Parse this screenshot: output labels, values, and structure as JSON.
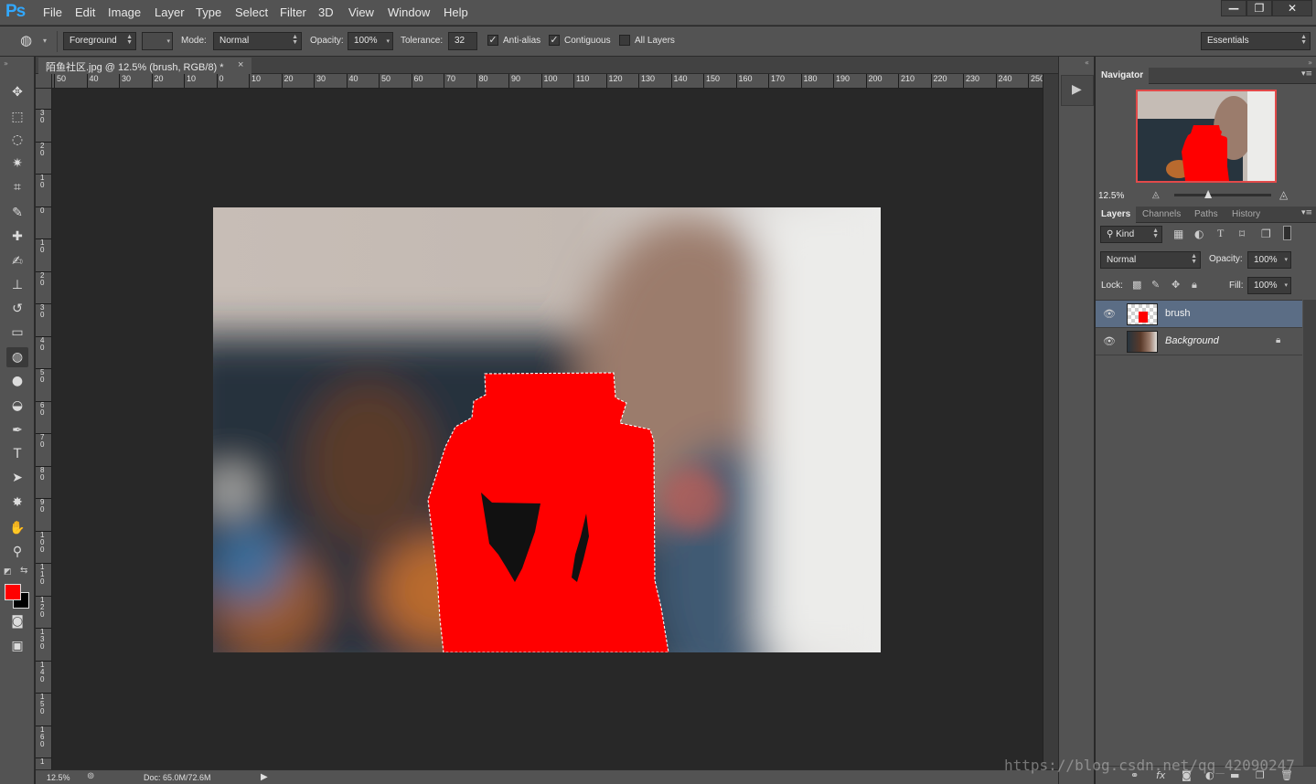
{
  "app": {
    "logo": "Ps"
  },
  "menu": [
    "File",
    "Edit",
    "Image",
    "Layer",
    "Type",
    "Select",
    "Filter",
    "3D",
    "View",
    "Window",
    "Help"
  ],
  "window_controls": {
    "minimize": "—",
    "restore": "❐",
    "close": "✕"
  },
  "options": {
    "fill_source": "Foreground",
    "mode_label": "Mode:",
    "mode_value": "Normal",
    "opacity_label": "Opacity:",
    "opacity_value": "100%",
    "tolerance_label": "Tolerance:",
    "tolerance_value": "32",
    "antialias_label": "Anti-alias",
    "antialias_checked": true,
    "contiguous_label": "Contiguous",
    "contiguous_checked": true,
    "alllayers_label": "All Layers",
    "alllayers_checked": false,
    "workspace": "Essentials",
    "check_glyph": "✓"
  },
  "document": {
    "tab_title": "陌鱼社区.jpg @ 12.5% (brush, RGB/8) *",
    "close_glyph": "×"
  },
  "rulers": {
    "horizontal": [
      "50",
      "40",
      "30",
      "20",
      "10",
      "0",
      "10",
      "20",
      "30",
      "40",
      "50",
      "60",
      "70",
      "80",
      "90",
      "100",
      "110",
      "120",
      "130",
      "140",
      "150",
      "160",
      "170",
      "180",
      "190",
      "200",
      "210",
      "220",
      "230",
      "240",
      "250"
    ],
    "vertical": [
      "3\n0",
      "2\n0",
      "1\n0",
      "0",
      "1\n0",
      "2\n0",
      "3\n0",
      "4\n0",
      "5\n0",
      "6\n0",
      "7\n0",
      "8\n0",
      "9\n0",
      "1\n0\n0",
      "1\n1\n0",
      "1\n2\n0",
      "1\n3\n0",
      "1\n4\n0",
      "1\n5\n0",
      "1\n6\n0",
      "1"
    ]
  },
  "tools": [
    {
      "name": "move-tool-icon",
      "glyph": "✥"
    },
    {
      "name": "marquee-tool-icon",
      "glyph": "⬚"
    },
    {
      "name": "lasso-tool-icon",
      "glyph": "◌"
    },
    {
      "name": "magic-wand-tool-icon",
      "glyph": "✷"
    },
    {
      "name": "crop-tool-icon",
      "glyph": "⌗"
    },
    {
      "name": "eyedropper-tool-icon",
      "glyph": "✎"
    },
    {
      "name": "healing-brush-tool-icon",
      "glyph": "✚"
    },
    {
      "name": "brush-tool-icon",
      "glyph": "✍"
    },
    {
      "name": "clone-stamp-tool-icon",
      "glyph": "⊥"
    },
    {
      "name": "history-brush-tool-icon",
      "glyph": "↺"
    },
    {
      "name": "eraser-tool-icon",
      "glyph": "▭"
    },
    {
      "name": "paint-bucket-tool-icon",
      "glyph": "◍"
    },
    {
      "name": "blur-tool-icon",
      "glyph": "●"
    },
    {
      "name": "dodge-tool-icon",
      "glyph": "◒"
    },
    {
      "name": "pen-tool-icon",
      "glyph": "✒"
    },
    {
      "name": "type-tool-icon",
      "glyph": "T"
    },
    {
      "name": "path-selection-tool-icon",
      "glyph": "➤"
    },
    {
      "name": "custom-shape-tool-icon",
      "glyph": "✸"
    },
    {
      "name": "hand-tool-icon",
      "glyph": "✋"
    },
    {
      "name": "zoom-tool-icon",
      "glyph": "⚲"
    },
    {
      "name": "quick-mask-icon",
      "glyph": "◙"
    },
    {
      "name": "screen-mode-icon",
      "glyph": "▣"
    }
  ],
  "colors": {
    "foreground": "#ff0000",
    "background": "#000000",
    "selection_fill": "#ff0000"
  },
  "status": {
    "zoom": "12.5%",
    "doc_info": "Doc: 65.0M/72.6M",
    "arrow": "▶"
  },
  "navigator": {
    "tab": "Navigator",
    "zoom": "12.5%",
    "slider_level": 0.35
  },
  "layers_panel": {
    "tabs": [
      "Layers",
      "Channels",
      "Paths",
      "History"
    ],
    "kind": "Kind",
    "blend_mode": "Normal",
    "opacity_label": "Opacity:",
    "opacity_value": "100%",
    "lock_label": "Lock:",
    "fill_label": "Fill:",
    "fill_value": "100%",
    "layers": [
      {
        "name": "brush",
        "selected": true,
        "locked": false
      },
      {
        "name": "Background",
        "selected": false,
        "locked": true
      }
    ],
    "footer_icons": [
      "link-icon",
      "fx-icon",
      "mask-icon",
      "adjustment-icon",
      "group-icon",
      "new-layer-icon",
      "trash-icon"
    ]
  },
  "watermark": "https://blog.csdn.net/qq_42090247"
}
